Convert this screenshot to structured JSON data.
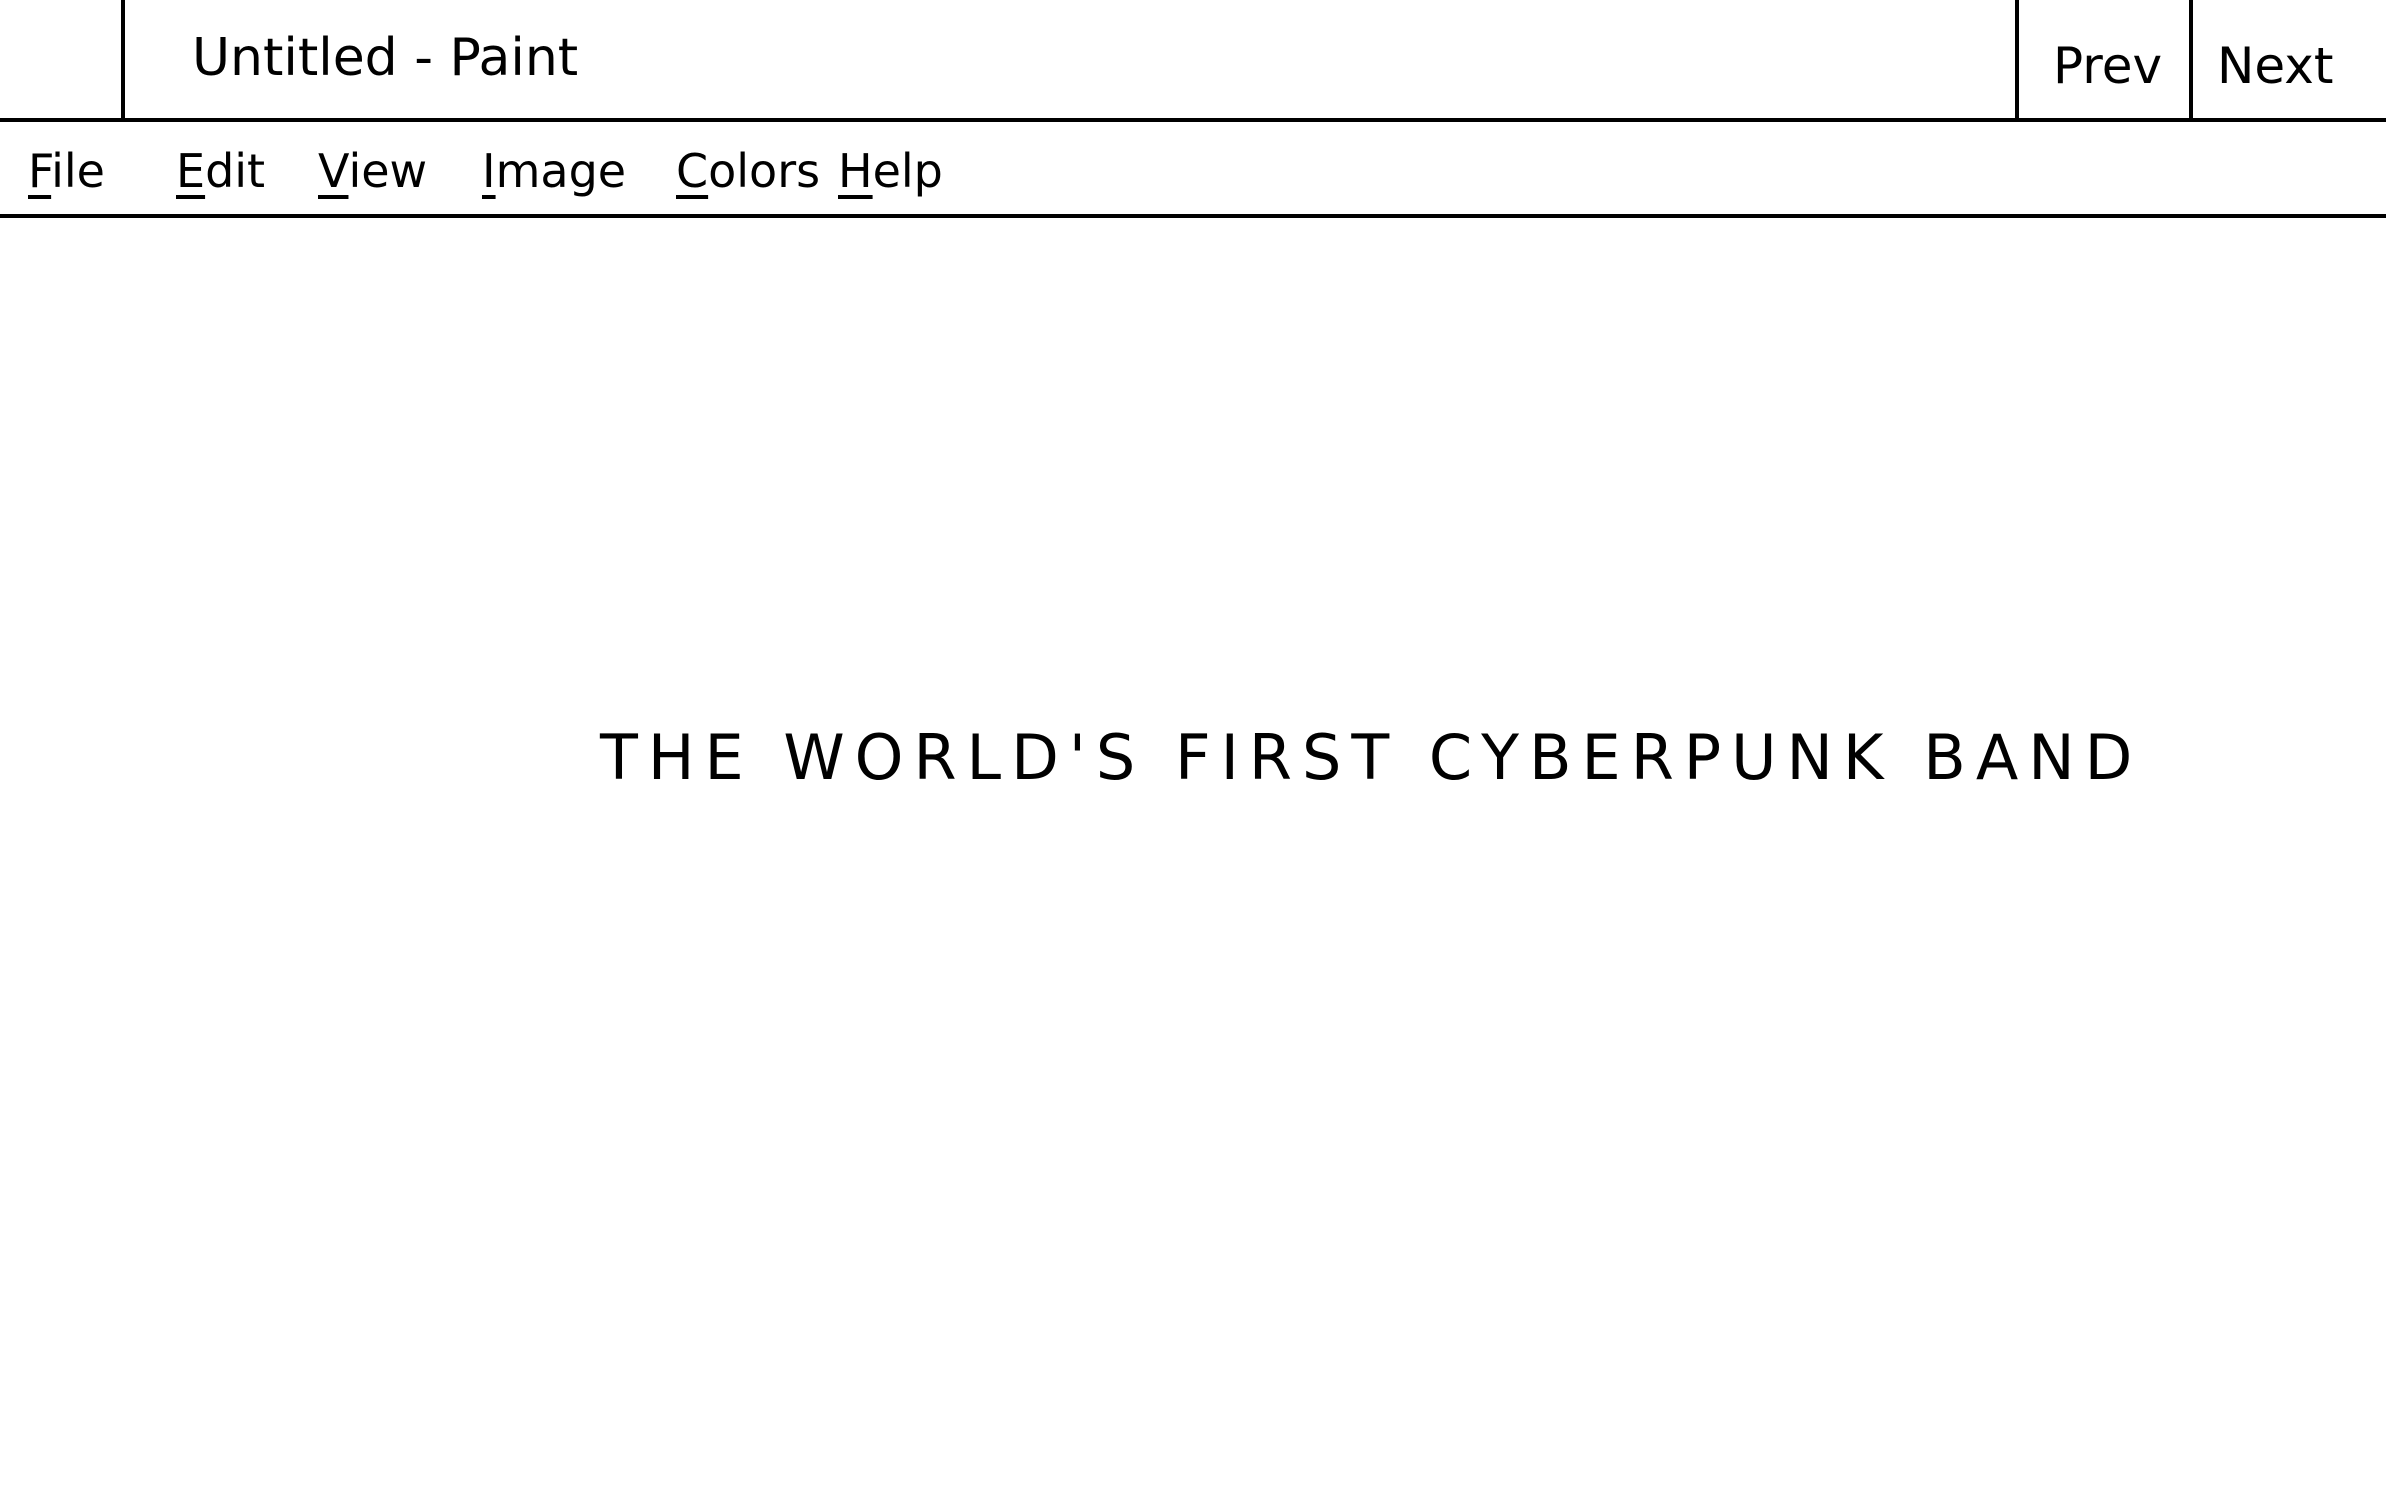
{
  "window": {
    "title": "Untitled - Paint",
    "prev_label": "Prev",
    "next_label": "Next"
  },
  "menu": {
    "items": [
      {
        "accel": "F",
        "rest": "ile"
      },
      {
        "accel": "E",
        "rest": "dit"
      },
      {
        "accel": "V",
        "rest": "iew"
      },
      {
        "accel": "I",
        "rest": "mage"
      },
      {
        "accel": "C",
        "rest": "olors"
      },
      {
        "accel": "H",
        "rest": "elp"
      }
    ]
  },
  "canvas": {
    "text": "THE WORLD'S FIRST CYBERPUNK BAND"
  }
}
